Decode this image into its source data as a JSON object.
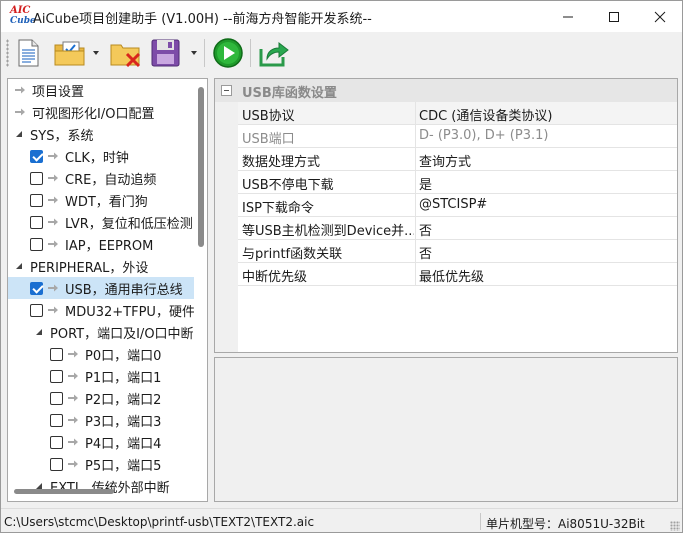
{
  "window": {
    "title": "AiCube项目创建助手 (V1.00H) --前海方舟智能开发系统--",
    "logo_line1": "AIC",
    "logo_line2": "Cube"
  },
  "tree": {
    "items": [
      {
        "label": "项目设置",
        "level": 0,
        "kind": "arrow"
      },
      {
        "label": "可视图形化I/O口配置",
        "level": 0,
        "kind": "arrow"
      },
      {
        "label": "SYS，系统",
        "level": 0,
        "kind": "expanded"
      },
      {
        "label": "CLK，时钟",
        "level": 1,
        "kind": "check",
        "checked": true
      },
      {
        "label": "CRE，自动追频",
        "level": 1,
        "kind": "check",
        "checked": false
      },
      {
        "label": "WDT，看门狗",
        "level": 1,
        "kind": "check",
        "checked": false
      },
      {
        "label": "LVR，复位和低压检测",
        "level": 1,
        "kind": "check",
        "checked": false
      },
      {
        "label": "IAP，EEPROM",
        "level": 1,
        "kind": "check",
        "checked": false
      },
      {
        "label": "PERIPHERAL，外设",
        "level": 0,
        "kind": "expanded"
      },
      {
        "label": "USB，通用串行总线",
        "level": 1,
        "kind": "check",
        "checked": true,
        "selected": true
      },
      {
        "label": "MDU32+TFPU，硬件",
        "level": 1,
        "kind": "check",
        "checked": false
      },
      {
        "label": "PORT，端口及I/O口中断",
        "level": 1,
        "kind": "expanded"
      },
      {
        "label": "P0口，端口0",
        "level": 2,
        "kind": "check",
        "checked": false
      },
      {
        "label": "P1口，端口1",
        "level": 2,
        "kind": "check",
        "checked": false
      },
      {
        "label": "P2口，端口2",
        "level": 2,
        "kind": "check",
        "checked": false
      },
      {
        "label": "P3口，端口3",
        "level": 2,
        "kind": "check",
        "checked": false
      },
      {
        "label": "P4口，端口4",
        "level": 2,
        "kind": "check",
        "checked": false
      },
      {
        "label": "P5口，端口5",
        "level": 2,
        "kind": "check",
        "checked": false
      },
      {
        "label": "EXTI，传统外部中断",
        "level": 1,
        "kind": "expanded"
      }
    ]
  },
  "properties": {
    "category": "USB库函数设置",
    "rows": [
      {
        "name": "USB协议",
        "value": "CDC (通信设备类协议)",
        "disabled": false,
        "selected": true
      },
      {
        "name": "USB端口",
        "value": "D- (P3.0), D+ (P3.1)",
        "disabled": true
      },
      {
        "name": "数据处理方式",
        "value": "查询方式",
        "disabled": false
      },
      {
        "name": "USB不停电下载",
        "value": "是",
        "disabled": false
      },
      {
        "name": "ISP下载命令",
        "value": "@STCISP#",
        "disabled": false
      },
      {
        "name": "等USB主机检测到Device并...",
        "value": "否",
        "disabled": false
      },
      {
        "name": "与printf函数关联",
        "value": "否",
        "disabled": false
      },
      {
        "name": "中断优先级",
        "value": "最低优先级",
        "disabled": false
      }
    ]
  },
  "status": {
    "path": "C:\\Users\\stcmc\\Desktop\\printf-usb\\TEXT2\\TEXT2.aic",
    "chip": "单片机型号：Ai8051U-32Bit"
  },
  "colors": {
    "accent": "#1a6fd1",
    "selection": "#cce4f7",
    "run_green": "#1f9a2b"
  }
}
